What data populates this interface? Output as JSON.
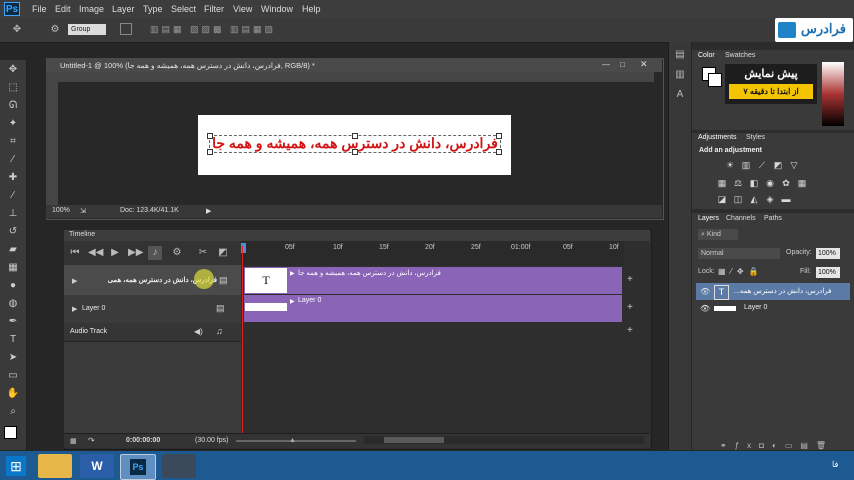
{
  "app": {
    "logo": "Ps"
  },
  "menu": [
    "File",
    "Edit",
    "Image",
    "Layer",
    "Type",
    "Select",
    "Filter",
    "View",
    "Window",
    "Help"
  ],
  "options_bar": {
    "auto_select": "Group",
    "icons": [
      "move-icon",
      "auto-select-icon",
      "transform-controls-icon"
    ]
  },
  "document": {
    "tab_title": "Untitled-1 @ 100% (فرادرس، دانش در دسترس همه، همیشه و همه جا, RGB/8) *",
    "canvas_text": "فرادرس، دانش در دسترس همه، همیشه و همه جا",
    "zoom": "100%",
    "doc_size": "Doc: 123.4K/41.1K"
  },
  "timeline": {
    "title": "Timeline",
    "ruler_labels": [
      "05f",
      "10f",
      "15f",
      "20f",
      "25f",
      "01:00f",
      "05f",
      "10f"
    ],
    "tracks": [
      {
        "label": "فرادرس، دانش در دسترس همه، همی",
        "clip_label": "فرادرس، دانش در دسترس همه، همیشه و همه جا",
        "thumb": "T"
      },
      {
        "label": "Layer 0",
        "clip_label": "Layer 0"
      },
      {
        "label": "Audio Track"
      }
    ],
    "timecode": "0:00:00:00",
    "fps": "(30.00 fps)"
  },
  "panels": {
    "color_tabs": [
      "Color",
      "Swatches"
    ],
    "adjustments_tabs": [
      "Adjustments",
      "Styles"
    ],
    "add_adjustment": "Add an adjustment",
    "layers_tabs": [
      "Layers",
      "Channels",
      "Paths"
    ],
    "kind": "Kind",
    "blend_mode": "Normal",
    "opacity_label": "Opacity:",
    "opacity": "100%",
    "lock_label": "Lock:",
    "fill_label": "Fill:",
    "fill": "100%",
    "layers": [
      {
        "name": "فرادرس، دانش در دسترس همه..."
      },
      {
        "name": "Layer 0"
      }
    ]
  },
  "brand": {
    "name": "فرادرس"
  },
  "promo": {
    "title": "پیش نمایش",
    "subtitle": "از ابتدا تا دقیقه ۷"
  },
  "taskbar": {
    "lang": "فا"
  }
}
